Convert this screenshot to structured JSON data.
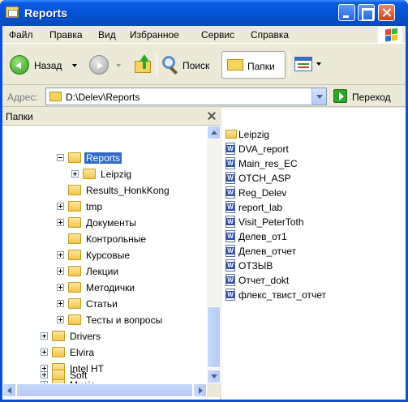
{
  "window": {
    "title": "Reports"
  },
  "menu": [
    "Файл",
    "Правка",
    "Вид",
    "Избранное",
    "Сервис",
    "Справка"
  ],
  "toolbar": {
    "back_label": "Назад",
    "search_label": "Поиск",
    "folders_label": "Папки"
  },
  "address": {
    "label": "Адрес:",
    "value": "D:\\Delev\\Reports",
    "go_label": "Переход"
  },
  "folder_pane": {
    "title": "Папки",
    "tree": [
      {
        "label": "Reports",
        "expander": "minus",
        "selected": true
      },
      {
        "label": "Leipzig",
        "expander": "plus"
      },
      {
        "label": "Results_HonkKong",
        "expander": "none"
      },
      {
        "label": "tmp",
        "expander": "plus"
      },
      {
        "label": "Документы",
        "expander": "plus"
      },
      {
        "label": "Контрольные",
        "expander": "none"
      },
      {
        "label": "Курсовые",
        "expander": "plus"
      },
      {
        "label": "Лекции",
        "expander": "plus"
      },
      {
        "label": "Методички",
        "expander": "plus"
      },
      {
        "label": "Статьи",
        "expander": "plus"
      },
      {
        "label": "Тесты и вопросы",
        "expander": "plus"
      },
      {
        "label": "Drivers",
        "expander": "plus"
      },
      {
        "label": "Elvira",
        "expander": "plus"
      },
      {
        "label": "Intel HT",
        "expander": "plus"
      },
      {
        "label": "Music",
        "expander": "plus"
      },
      {
        "label": "Soft",
        "expander": "plus"
      }
    ]
  },
  "files": [
    {
      "name": "Leipzig",
      "type": "folder"
    },
    {
      "name": "DVA_report",
      "type": "doc"
    },
    {
      "name": "Main_res_EC",
      "type": "doc"
    },
    {
      "name": "OTCH_ASP",
      "type": "doc"
    },
    {
      "name": "Reg_Delev",
      "type": "doc"
    },
    {
      "name": "report_lab",
      "type": "doc"
    },
    {
      "name": "Visit_PeterToth",
      "type": "doc"
    },
    {
      "name": "Делев_от1",
      "type": "doc"
    },
    {
      "name": "Делев_отчет",
      "type": "doc"
    },
    {
      "name": "ОТЗЫВ",
      "type": "doc"
    },
    {
      "name": "Отчет_dokt",
      "type": "doc"
    },
    {
      "name": "флекс_твист_отчет",
      "type": "doc"
    }
  ],
  "colors": {
    "titlebar": "#0653D8",
    "selection": "#316AC5",
    "window_bg": "#ECE9D8"
  }
}
